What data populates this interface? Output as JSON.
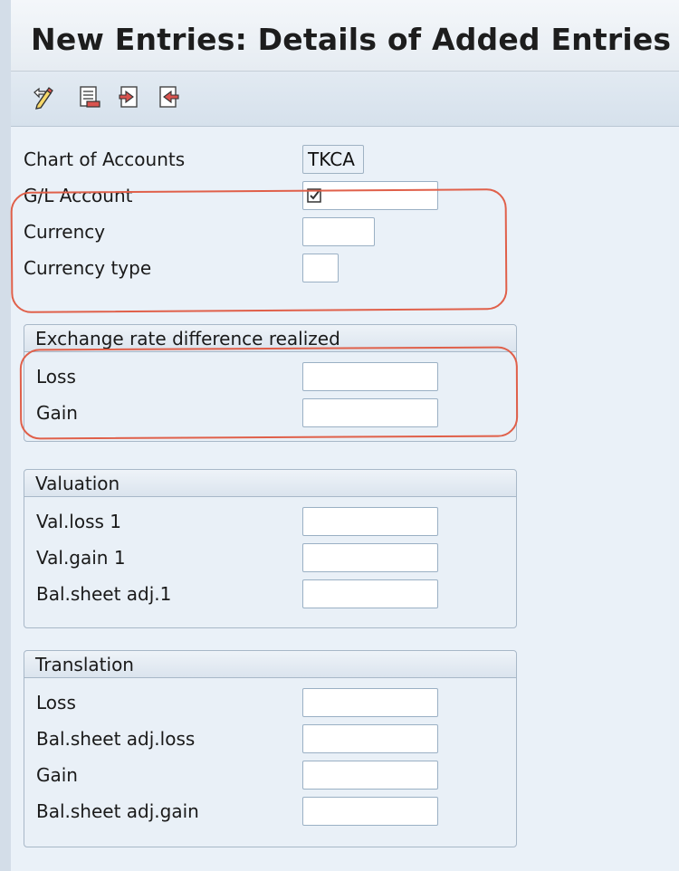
{
  "window": {
    "title": "New Entries: Details of Added Entries"
  },
  "toolbar": {
    "buttons": [
      {
        "icon": "display-change-icon"
      },
      {
        "icon": "delete-icon"
      },
      {
        "icon": "previous-entry-icon"
      },
      {
        "icon": "next-entry-icon"
      }
    ]
  },
  "header_fields": {
    "chart_of_accounts": {
      "label": "Chart of Accounts",
      "value": "TKCA"
    },
    "gl_account": {
      "label": "G/L Account",
      "value": ""
    },
    "currency": {
      "label": "Currency",
      "value": ""
    },
    "currency_type": {
      "label": "Currency type",
      "value": ""
    }
  },
  "groups": {
    "realized": {
      "title": "Exchange rate difference realized",
      "loss": {
        "label": "Loss",
        "value": ""
      },
      "gain": {
        "label": "Gain",
        "value": ""
      }
    },
    "valuation": {
      "title": "Valuation",
      "val_loss_1": {
        "label": "Val.loss 1",
        "value": ""
      },
      "val_gain_1": {
        "label": "Val.gain 1",
        "value": ""
      },
      "bal_sheet_adj_1": {
        "label": "Bal.sheet adj.1",
        "value": ""
      }
    },
    "translation": {
      "title": "Translation",
      "loss": {
        "label": "Loss",
        "value": ""
      },
      "bal_sheet_adj_loss": {
        "label": "Bal.sheet adj.loss",
        "value": ""
      },
      "gain": {
        "label": "Gain",
        "value": ""
      },
      "bal_sheet_adj_gain": {
        "label": "Bal.sheet adj.gain",
        "value": ""
      }
    }
  },
  "colors": {
    "highlight": "#e0604a",
    "background": "#e9f0f7"
  }
}
